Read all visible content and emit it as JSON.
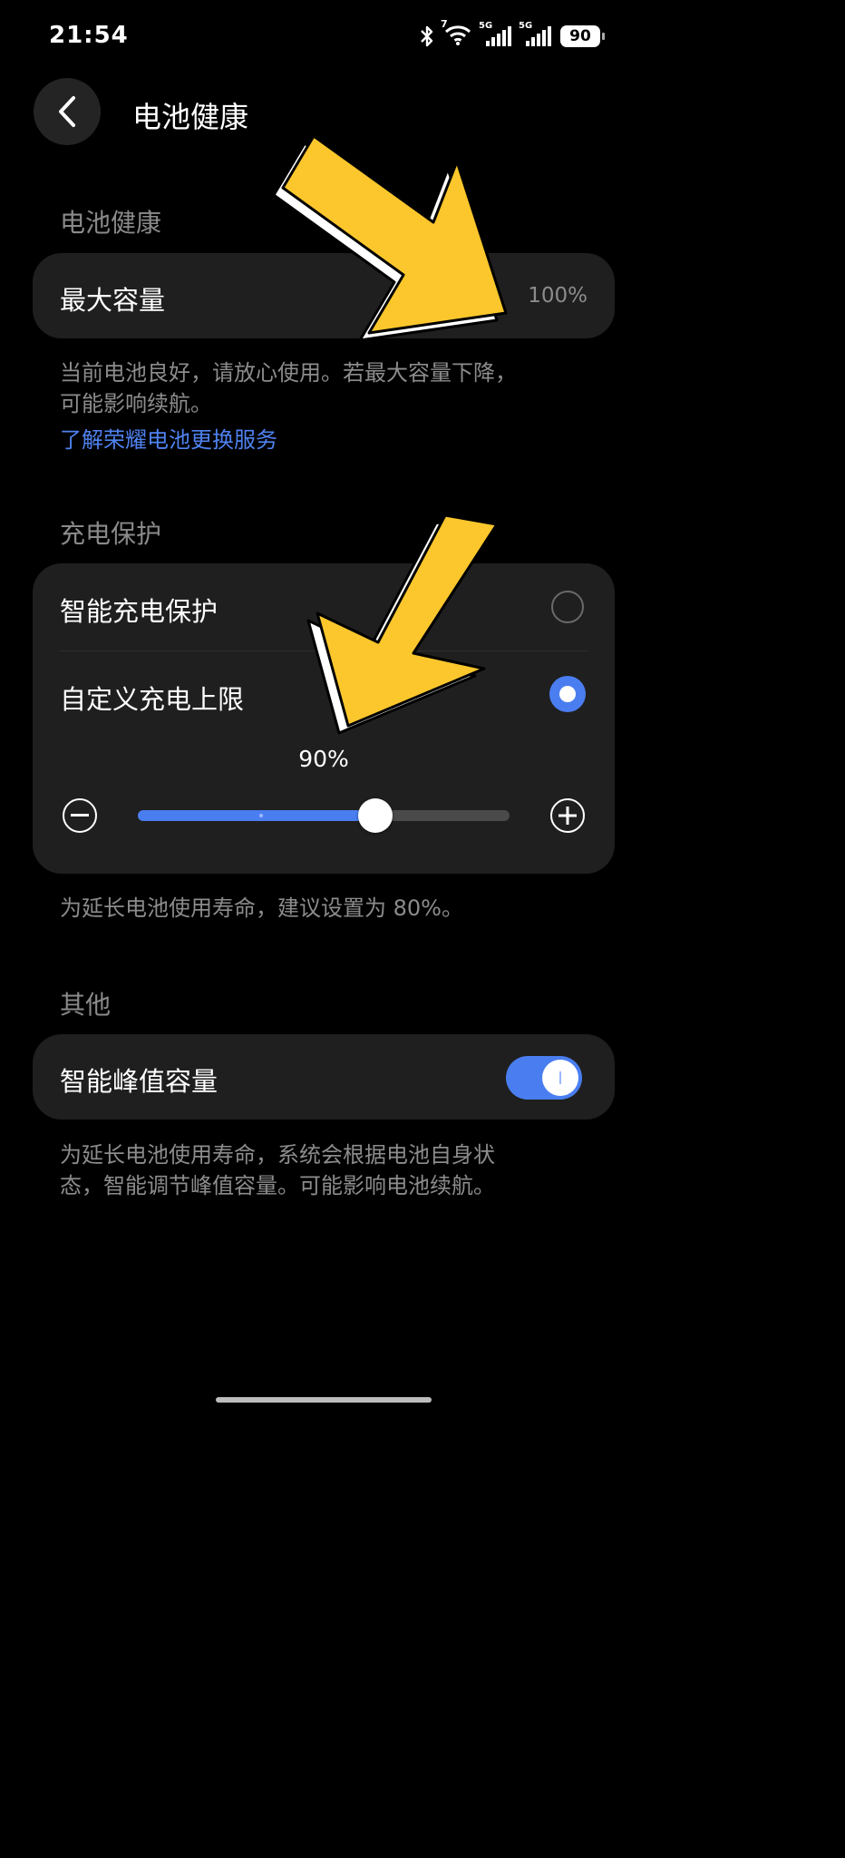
{
  "status_bar": {
    "time": "21:54",
    "wifi_badge": "7",
    "sim1_label": "5G",
    "sim2_label": "5G",
    "battery": "90",
    "icons": [
      "bluetooth-icon",
      "wifi-icon",
      "signal-icon",
      "signal-icon",
      "battery-icon"
    ]
  },
  "header": {
    "title": "电池健康",
    "back_icon": "chevron-left-icon"
  },
  "battery_health": {
    "section_title": "电池健康",
    "max_capacity_label": "最大容量",
    "max_capacity_value": "100%",
    "desc_line1": "当前电池良好，请放心使用。若最大容量下降，",
    "desc_line2": "可能影响续航。",
    "link": "了解荣耀电池更换服务"
  },
  "charge_protection": {
    "section_title": "充电保护",
    "options": [
      {
        "label": "智能充电保护",
        "selected": false
      },
      {
        "label": "自定义充电上限",
        "selected": true
      }
    ],
    "limit_value": "90%",
    "slider_fraction": 0.64,
    "desc": "为延长电池使用寿命，建议设置为 80%。"
  },
  "other": {
    "section_title": "其他",
    "peak_capacity_label": "智能峰值容量",
    "peak_capacity_enabled": true,
    "desc_line1": "为延长电池使用寿命，系统会根据电池自身状",
    "desc_line2": "态，智能调节峰值容量。可能影响电池续航。"
  },
  "colors": {
    "accent": "#4a7ef0",
    "card": "#1f1f1f",
    "annotation_arrow": "#fcc72c"
  }
}
